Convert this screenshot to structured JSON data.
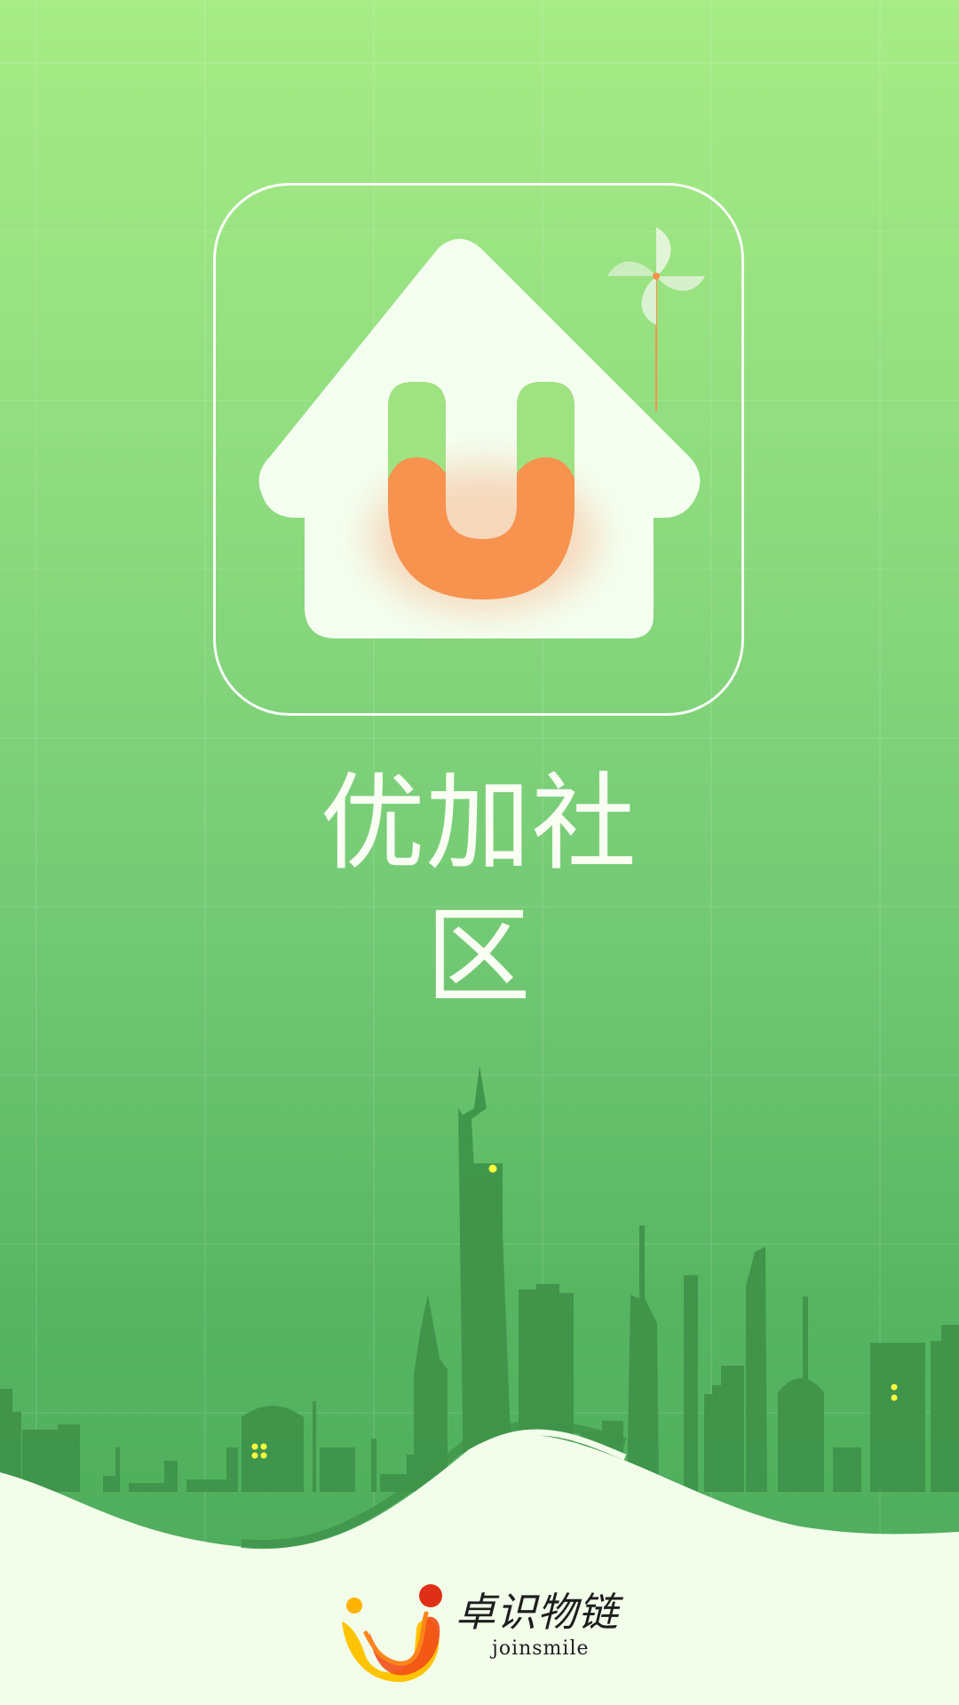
{
  "app": {
    "name": "优加社区"
  },
  "icon": {
    "name": "house-u-logo-icon",
    "pinwheel": "pinwheel-icon"
  },
  "brand": {
    "chinese": "卓识物链",
    "english": "joinsmile",
    "mark": "joinsmile-logo-icon"
  },
  "colors": {
    "primary_green": "#8fdc7f",
    "dark_green": "#3f944a",
    "white": "#f5fff0",
    "orange": "#f7924f",
    "brand_red": "#df2f17",
    "brand_yellow": "#ffc400"
  }
}
